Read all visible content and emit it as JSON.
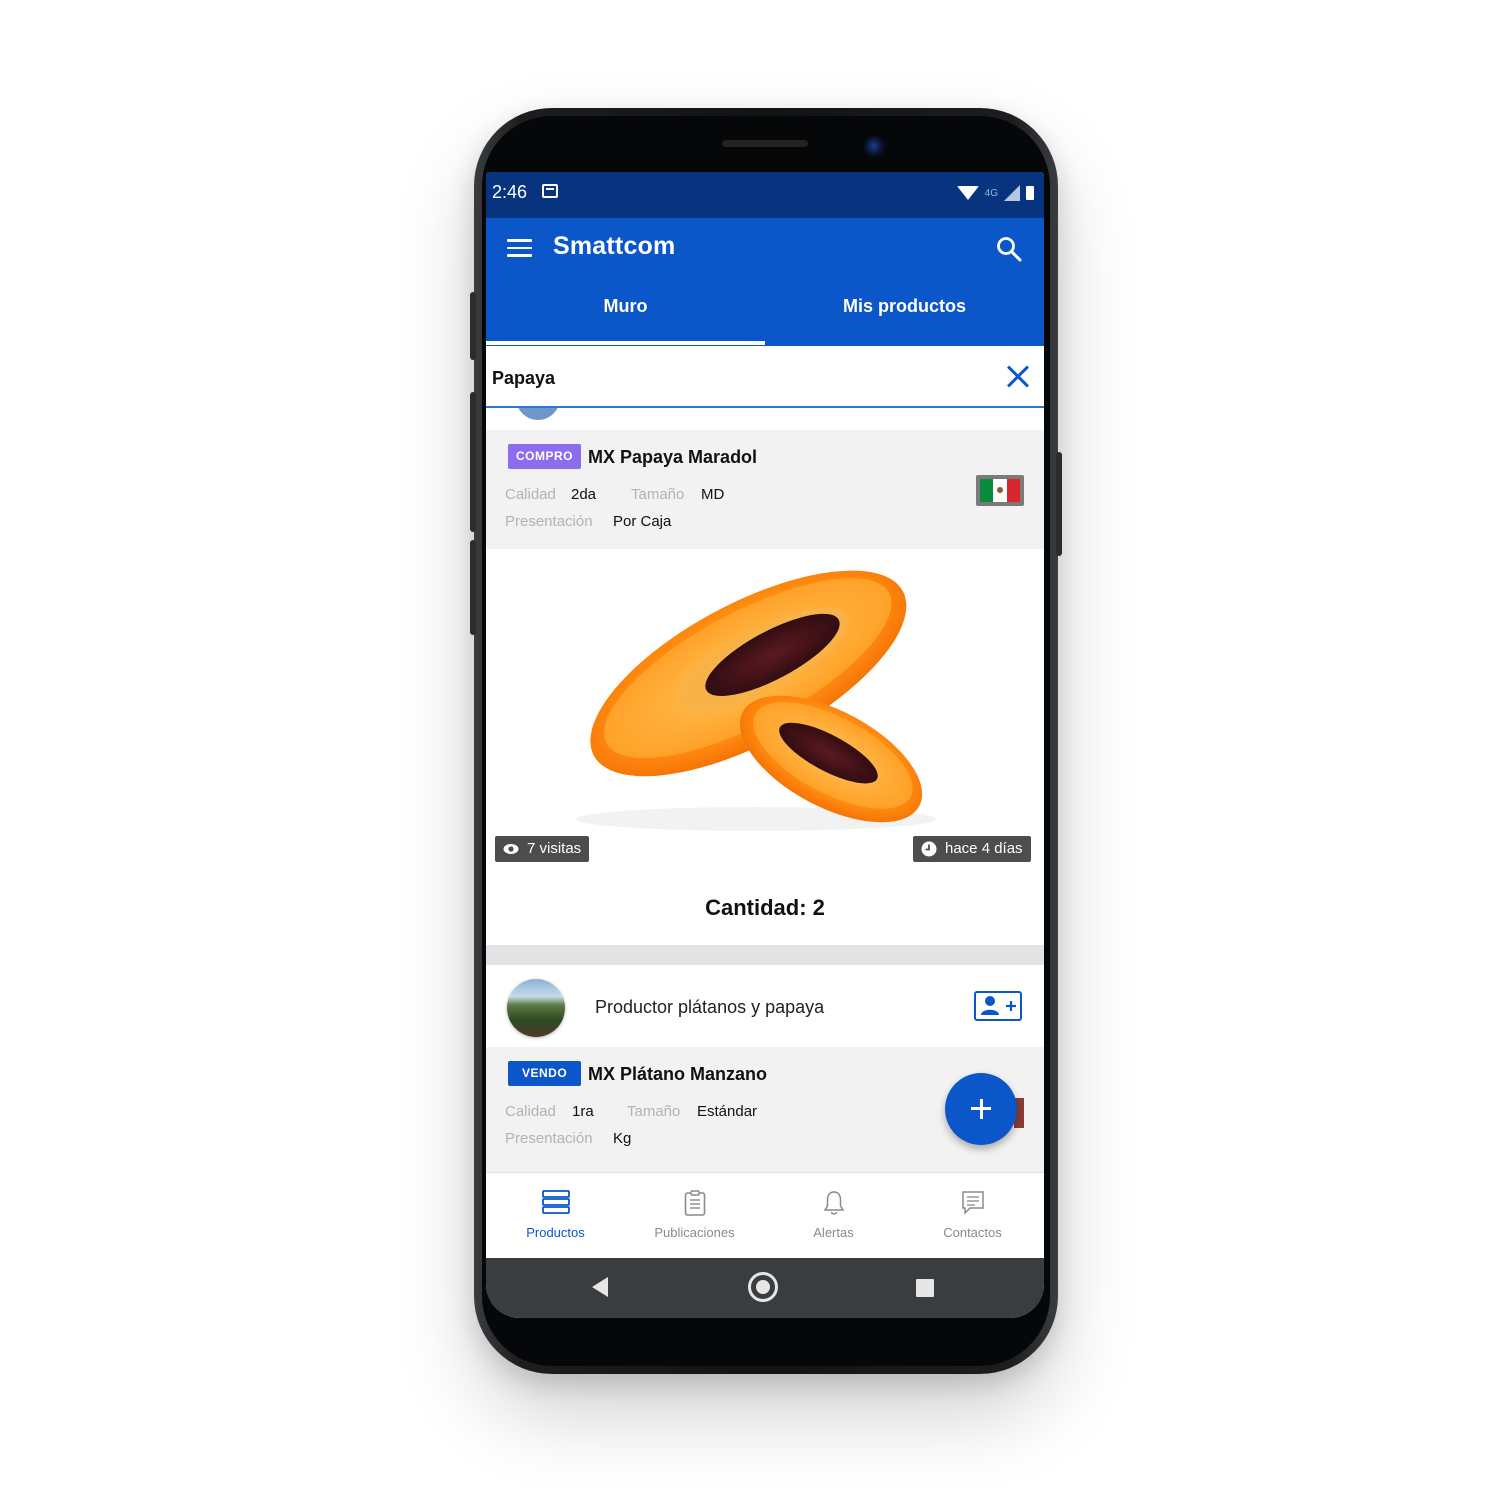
{
  "status": {
    "time": "2:46",
    "network": "4G"
  },
  "appbar": {
    "title": "Smattcom"
  },
  "tabs": [
    {
      "label": "Muro",
      "active": true
    },
    {
      "label": "Mis productos",
      "active": false
    }
  ],
  "search": {
    "query": "Papaya"
  },
  "listing1": {
    "badge": "COMPRO",
    "title": "MX Papaya Maradol",
    "calidad_label": "Calidad",
    "calidad": "2da",
    "tamano_label": "Tamaño",
    "tamano": "MD",
    "presentacion_label": "Presentación",
    "presentacion": "Por Caja",
    "visits": "7 visitas",
    "time_ago": "hace 4 días",
    "quantity": "Cantidad: 2"
  },
  "seller": {
    "name": "Productor plátanos y papaya"
  },
  "listing2": {
    "badge": "VENDO",
    "title": "MX Plátano Manzano",
    "calidad_label": "Calidad",
    "calidad": "1ra",
    "tamano_label": "Tamaño",
    "tamano": "Estándar",
    "presentacion_label": "Presentación",
    "presentacion": "Kg"
  },
  "bottom_nav": [
    {
      "label": "Productos",
      "icon": "products-icon",
      "active": true
    },
    {
      "label": "Publicaciones",
      "icon": "clipboard-icon",
      "active": false
    },
    {
      "label": "Alertas",
      "icon": "bell-icon",
      "active": false
    },
    {
      "label": "Contactos",
      "icon": "chat-icon",
      "active": false
    }
  ],
  "colors": {
    "primary": "#0b56c8",
    "status_bar": "#08337f",
    "compro_badge": "#8e6cf0",
    "chip": "#4d4d4d"
  }
}
